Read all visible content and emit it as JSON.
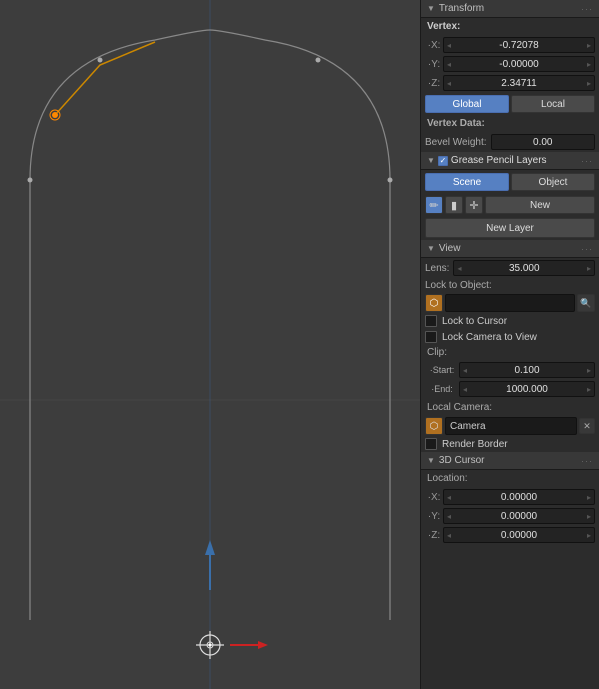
{
  "viewport": {
    "bg_color": "#3d3d3d"
  },
  "panel": {
    "transform": {
      "title": "Transform",
      "vertex_label": "Vertex:",
      "x_label": "X:",
      "x_value": "-0.72078",
      "y_label": "Y:",
      "y_value": "-0.00000",
      "z_label": "Z:",
      "z_value": "2.34711",
      "global_btn": "Global",
      "local_btn": "Local",
      "vertex_data_label": "Vertex Data:",
      "bevel_label": "Bevel Weight:",
      "bevel_value": "0.00"
    },
    "grease_pencil": {
      "title": "Grease Pencil Layers",
      "scene_btn": "Scene",
      "object_btn": "Object",
      "new_btn": "New",
      "new_layer_btn": "New Layer"
    },
    "view": {
      "title": "View",
      "lens_label": "Lens:",
      "lens_value": "35.000",
      "lock_obj_label": "Lock to Object:",
      "lock_cursor_label": "Lock to Cursor",
      "lock_camera_label": "Lock Camera to View",
      "clip_label": "Clip:",
      "start_label": "Start:",
      "start_value": "0.100",
      "end_label": "End:",
      "end_value": "1000.000",
      "local_camera_label": "Local Camera:",
      "camera_label": "Camera",
      "render_border_label": "Render Border"
    },
    "cursor_3d": {
      "title": "3D Cursor",
      "location_label": "Location:",
      "x_label": "X:",
      "x_value": "0.00000",
      "y_label": "Y:",
      "y_value": "0.00000",
      "z_label": "Z:",
      "z_value": "0.00000"
    }
  }
}
